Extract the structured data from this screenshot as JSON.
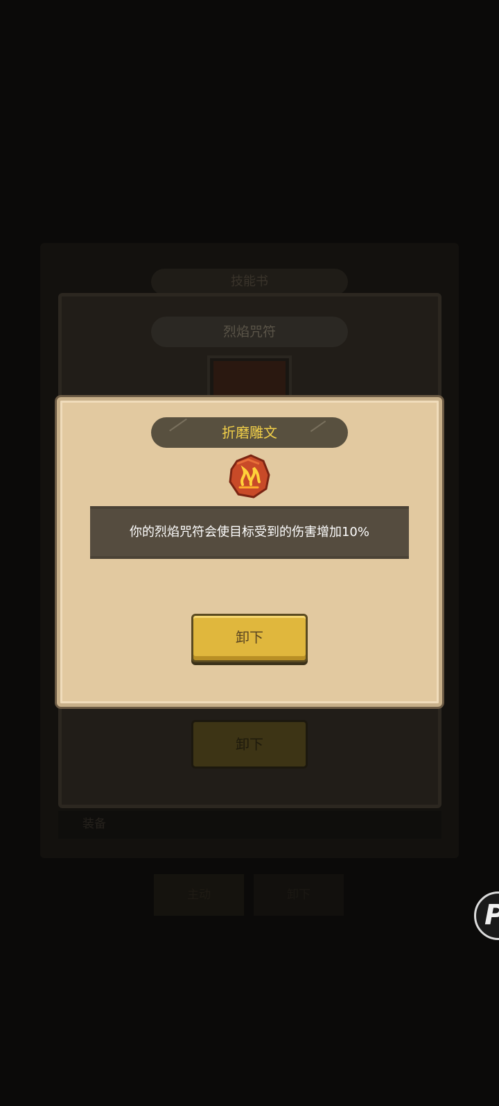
{
  "background": {
    "header_title": "技能书",
    "item_name": "烈焰咒符",
    "unequip_label": "卸下",
    "equip_label": "装备",
    "button_left": "主动",
    "button_right": "卸下"
  },
  "modal": {
    "title": "折磨雕文",
    "icon": "flame-rune-icon",
    "description": "你的烈焰咒符会使目标受到的伤害增加10%",
    "unequip_button_label": "卸下"
  },
  "floating_button": {
    "icon": "assistive-touch-icon",
    "glyph": "P"
  },
  "colors": {
    "modal_bg": "#e2c9a0",
    "title_text": "#f1cf49",
    "button_gold": "#e0b73d",
    "desc_box": "#554c3f"
  }
}
